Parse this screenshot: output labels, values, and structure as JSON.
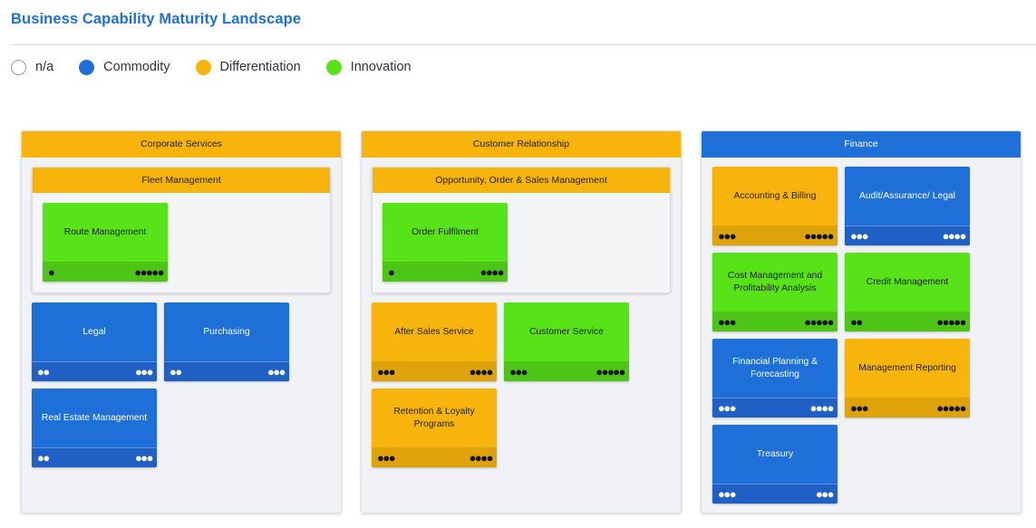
{
  "title": "Business Capability Maturity Landscape",
  "colors": {
    "commodity": "#1f6fd8",
    "differentiation": "#f7b40c",
    "innovation": "#58e319",
    "na": "#ffffff"
  },
  "legend": [
    {
      "key": "na",
      "label": "n/a"
    },
    {
      "key": "commodity",
      "label": "Commodity"
    },
    {
      "key": "differentiation",
      "label": "Differentiation"
    },
    {
      "key": "innovation",
      "label": "Innovation"
    }
  ],
  "domains": {
    "corporate": {
      "label": "Corporate Services",
      "color": "#f7b40c",
      "groups": {
        "fleet": {
          "label": "Fleet Management",
          "color": "#f7b40c",
          "cards": {
            "route": {
              "label": "Route Management",
              "category": "innovation",
              "left_dots": 1,
              "right_dots": 5
            }
          }
        }
      },
      "cards": {
        "legal": {
          "label": "Legal",
          "category": "commodity",
          "left_dots": 2,
          "right_dots": 3
        },
        "purchasing": {
          "label": "Purchasing",
          "category": "commodity",
          "left_dots": 2,
          "right_dots": 3
        },
        "real_estate": {
          "label": "Real Estate Management",
          "category": "commodity",
          "left_dots": 2,
          "right_dots": 3
        }
      }
    },
    "customer": {
      "label": "Customer Relationship",
      "color": "#f7b40c",
      "groups": {
        "opportunity": {
          "label": "Opportunity, Order & Sales Management",
          "color": "#f7b40c",
          "cards": {
            "order": {
              "label": "Order Fulfilment",
              "category": "innovation",
              "left_dots": 1,
              "right_dots": 4
            }
          }
        }
      },
      "cards": {
        "after_sales": {
          "label": "After Sales Service",
          "category": "differentiation",
          "left_dots": 3,
          "right_dots": 4
        },
        "customer_service": {
          "label": "Customer Service",
          "category": "innovation",
          "left_dots": 3,
          "right_dots": 5
        },
        "retention": {
          "label": "Retention & Loyalty Programs",
          "category": "differentiation",
          "left_dots": 3,
          "right_dots": 4
        }
      }
    },
    "finance": {
      "label": "Finance",
      "color": "#1f6fd8",
      "cards": {
        "accounting": {
          "label": "Accounting & Billing",
          "category": "differentiation",
          "left_dots": 3,
          "right_dots": 5
        },
        "audit": {
          "label": "Audit/Assurance/ Legal",
          "category": "commodity",
          "left_dots": 3,
          "right_dots": 4
        },
        "cost": {
          "label": "Cost Management and Profitability Analysis",
          "category": "innovation",
          "left_dots": 3,
          "right_dots": 5
        },
        "credit": {
          "label": "Credit Management",
          "category": "innovation",
          "left_dots": 2,
          "right_dots": 5
        },
        "planning": {
          "label": "Financial Planning & Forecasting",
          "category": "commodity",
          "left_dots": 3,
          "right_dots": 4
        },
        "reporting": {
          "label": "Management Reporting",
          "category": "differentiation",
          "left_dots": 3,
          "right_dots": 5
        },
        "treasury": {
          "label": "Treasury",
          "category": "commodity",
          "left_dots": 3,
          "right_dots": 3
        }
      }
    }
  }
}
